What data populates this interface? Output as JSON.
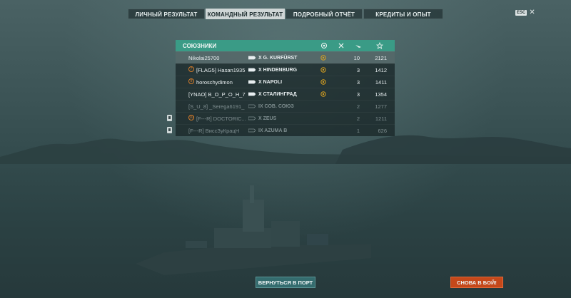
{
  "tabs": [
    {
      "label": "ЛИЧНЫЙ РЕЗУЛЬТАТ",
      "active": false
    },
    {
      "label": "КОМАНДНЫЙ РЕЗУЛЬТАТ",
      "active": true
    },
    {
      "label": "ПОДРОБНЫЙ ОТЧЁТ",
      "active": false
    },
    {
      "label": "КРЕДИТЫ И ОПЫТ",
      "active": false
    }
  ],
  "esc": {
    "badge": "ESC",
    "close": "✕"
  },
  "table": {
    "title": "СОЮЗНИКИ",
    "columns": [
      "medal-icon",
      "kills-icon",
      "planes-icon",
      "xp-star-icon"
    ],
    "rows": [
      {
        "player": "Nikolai25700",
        "ship": "X G. KURFÜRST",
        "kills": "10",
        "xp": "2121",
        "state": "me",
        "medal": true,
        "badge": "",
        "division": false
      },
      {
        "player": "[FLAG5] Hasan1935",
        "ship": "X HINDENBURG",
        "kills": "3",
        "xp": "1412",
        "state": "alive",
        "medal": true,
        "badge": "7",
        "division": false
      },
      {
        "player": "horoschydimon",
        "ship": "X NAPOLI",
        "kills": "3",
        "xp": "1411",
        "state": "alive",
        "medal": true,
        "badge": "8",
        "division": false
      },
      {
        "player": "[YNAO] В_О_Р_О_Н_7",
        "ship": "X СТАЛИНГРАД",
        "kills": "3",
        "xp": "1354",
        "state": "alive",
        "medal": true,
        "badge": "",
        "division": false
      },
      {
        "player": "[S_U_8] _Serega6191_",
        "ship": "IX СОВ. СОЮЗ",
        "kills": "2",
        "xp": "1277",
        "state": "dead",
        "medal": false,
        "badge": "",
        "division": false
      },
      {
        "player": "[F---R] DOCTORIC...",
        "ship": "X ZEUS",
        "kills": "2",
        "xp": "1211",
        "state": "dead",
        "medal": false,
        "badge": "10",
        "division": true
      },
      {
        "player": "[F---R] ВиссЗуКрацН",
        "ship": "IX AZUMA B",
        "kills": "1",
        "xp": "626",
        "state": "dead",
        "medal": false,
        "badge": "",
        "division": true
      }
    ]
  },
  "buttons": {
    "port": "ВЕРНУТЬСЯ В ПОРТ",
    "battle": "СНОВА В БОЙ!"
  },
  "colors": {
    "accent": "#3a9b86",
    "battle": "#c5481a",
    "port": "#346c6e",
    "medal": "#d7a020"
  }
}
